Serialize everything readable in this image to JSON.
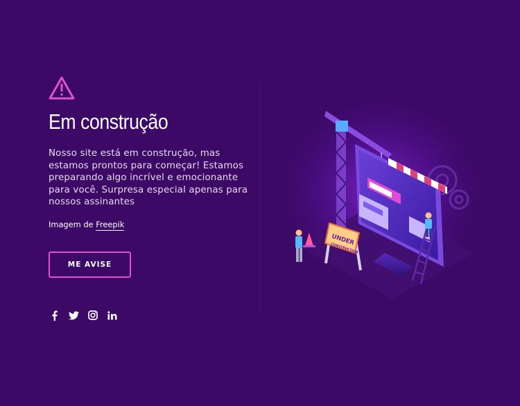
{
  "hero": {
    "title": "Em construção",
    "description": "Nosso site está em construção, mas estamos prontos para começar! Estamos preparando algo incrível e emocionante para você. Surpresa especial apenas para nossos assinantes",
    "credit_prefix": "Imagem de ",
    "credit_link": "Freepik",
    "notify_label": "ME AVISE"
  },
  "social": [
    {
      "name": "facebook-icon"
    },
    {
      "name": "twitter-icon"
    },
    {
      "name": "instagram-icon"
    },
    {
      "name": "linkedin-icon"
    }
  ],
  "illustration": {
    "sign_line1": "UNDER",
    "sign_line2": "CONSTRUCTION"
  },
  "colors": {
    "background": "#3c0966",
    "accent": "#e24fd3",
    "warning_icon": "#e24fd3",
    "text": "#ffffff"
  }
}
